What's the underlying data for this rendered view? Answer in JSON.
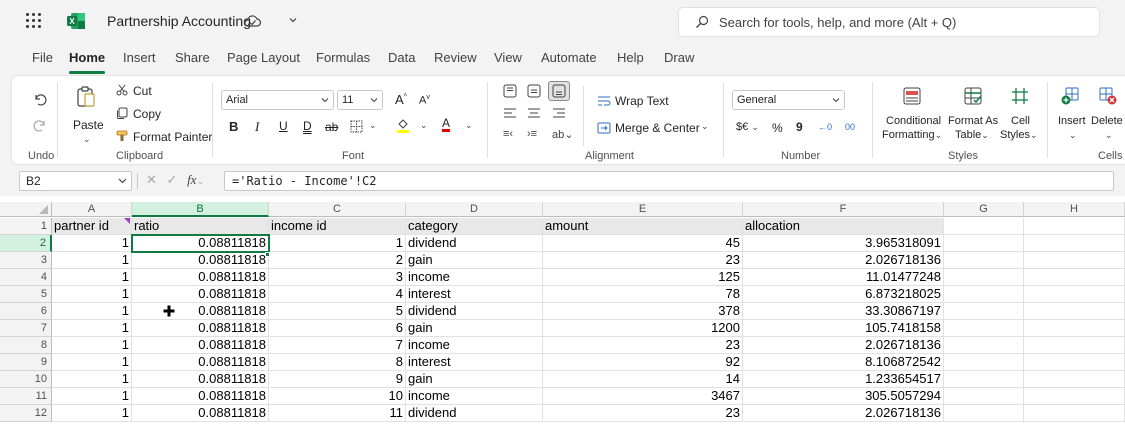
{
  "app": {
    "doc_title": "Partnership Accounting",
    "search_placeholder": "Search for tools, help, and more (Alt + Q)",
    "brand_color": "#107c41"
  },
  "menu": {
    "tabs": [
      {
        "label": "File"
      },
      {
        "label": "Home",
        "active": true
      },
      {
        "label": "Insert"
      },
      {
        "label": "Share"
      },
      {
        "label": "Page Layout"
      },
      {
        "label": "Formulas"
      },
      {
        "label": "Data"
      },
      {
        "label": "Review"
      },
      {
        "label": "View"
      },
      {
        "label": "Automate"
      },
      {
        "label": "Help"
      },
      {
        "label": "Draw"
      }
    ]
  },
  "ribbon": {
    "undo_group": {
      "label": "Undo"
    },
    "clipboard": {
      "label": "Clipboard",
      "paste": "Paste",
      "cut": "Cut",
      "copy": "Copy",
      "format_painter": "Format Painter"
    },
    "font": {
      "label": "Font",
      "family": "Arial",
      "size": "11",
      "bold": "B",
      "italic": "I",
      "underline": "U",
      "double_underline": "D",
      "strikethrough": "ab",
      "font_color_letter": "A",
      "grow": "A",
      "shrink": "A"
    },
    "alignment": {
      "label": "Alignment",
      "wrap_text": "Wrap Text",
      "merge_center": "Merge & Center"
    },
    "number": {
      "label": "Number",
      "format": "General",
      "currency": "$€",
      "percent": "%",
      "comma": "9",
      "increase_decimal": "←0",
      "decrease_decimal": "00"
    },
    "styles": {
      "label": "Styles",
      "conditional_1": "Conditional",
      "conditional_2": "Formatting",
      "format_as_1": "Format As",
      "format_as_2": "Table",
      "cell_styles_1": "Cell",
      "cell_styles_2": "Styles"
    },
    "cells": {
      "label": "Cells",
      "insert": "Insert",
      "delete": "Delete"
    }
  },
  "formula_bar": {
    "name_box": "B2",
    "fx": "fx",
    "formula": "='Ratio - Income'!C2"
  },
  "sheet": {
    "columns": [
      "A",
      "B",
      "C",
      "D",
      "E",
      "F",
      "G",
      "H"
    ],
    "selected_column": "B",
    "selected_row": "2",
    "active_cell": "B2",
    "rows": [
      {
        "num": "1",
        "cells": [
          "partner id",
          "ratio",
          "income id",
          "category",
          "amount",
          "allocation",
          "",
          ""
        ]
      },
      {
        "num": "2",
        "cells": [
          "1",
          "0.08811818",
          "1",
          "dividend",
          "45",
          "3.965318091",
          "",
          ""
        ]
      },
      {
        "num": "3",
        "cells": [
          "1",
          "0.08811818",
          "2",
          "gain",
          "23",
          "2.026718136",
          "",
          ""
        ]
      },
      {
        "num": "4",
        "cells": [
          "1",
          "0.08811818",
          "3",
          "income",
          "125",
          "11.01477248",
          "",
          ""
        ]
      },
      {
        "num": "5",
        "cells": [
          "1",
          "0.08811818",
          "4",
          "interest",
          "78",
          "6.873218025",
          "",
          ""
        ]
      },
      {
        "num": "6",
        "cells": [
          "1",
          "0.08811818",
          "5",
          "dividend",
          "378",
          "33.30867197",
          "",
          ""
        ]
      },
      {
        "num": "7",
        "cells": [
          "1",
          "0.08811818",
          "6",
          "gain",
          "1200",
          "105.7418158",
          "",
          ""
        ]
      },
      {
        "num": "8",
        "cells": [
          "1",
          "0.08811818",
          "7",
          "income",
          "23",
          "2.026718136",
          "",
          ""
        ]
      },
      {
        "num": "9",
        "cells": [
          "1",
          "0.08811818",
          "8",
          "interest",
          "92",
          "8.106872542",
          "",
          ""
        ]
      },
      {
        "num": "10",
        "cells": [
          "1",
          "0.08811818",
          "9",
          "gain",
          "14",
          "1.233654517",
          "",
          ""
        ]
      },
      {
        "num": "11",
        "cells": [
          "1",
          "0.08811818",
          "10",
          "income",
          "3467",
          "305.5057294",
          "",
          ""
        ]
      },
      {
        "num": "12",
        "cells": [
          "1",
          "0.08811818",
          "11",
          "dividend",
          "23",
          "2.026718136",
          "",
          ""
        ]
      }
    ]
  }
}
